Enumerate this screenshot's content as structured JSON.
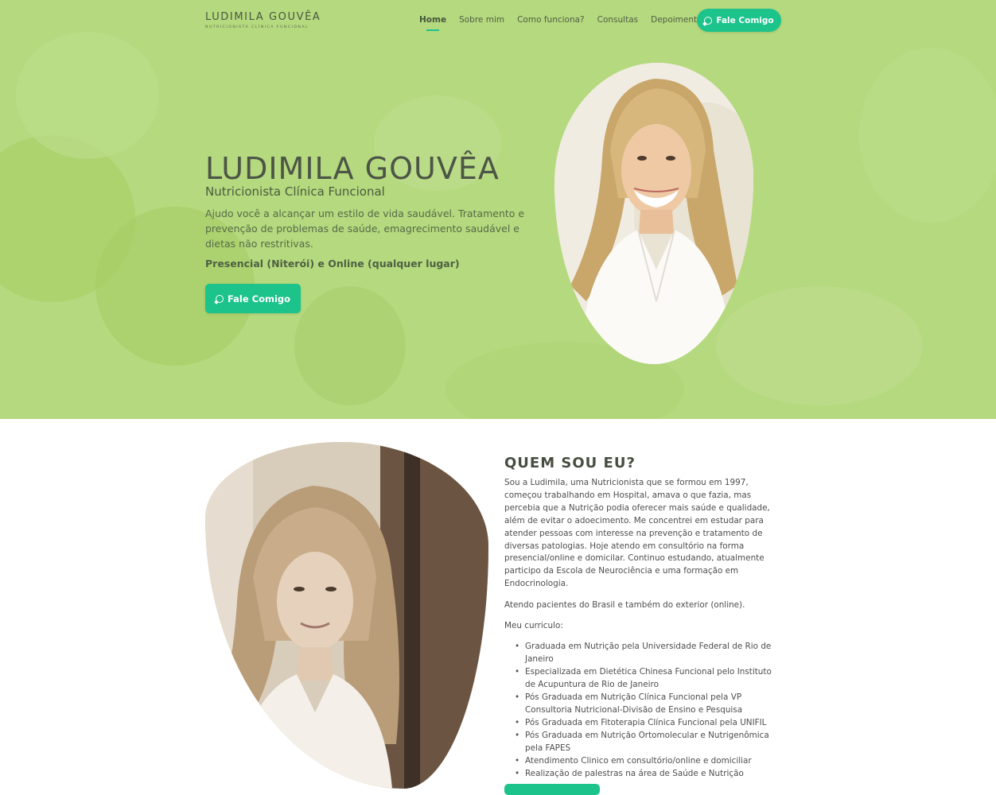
{
  "header": {
    "logo_main": "LUDIMILA GOUVÊA",
    "logo_sub": "NUTRICIONISTA CLÍNICA FUNCIONAL",
    "nav": [
      {
        "label": "Home",
        "active": true
      },
      {
        "label": "Sobre mim",
        "active": false
      },
      {
        "label": "Como funciona?",
        "active": false
      },
      {
        "label": "Consultas",
        "active": false
      },
      {
        "label": "Depoimentos",
        "active": false
      }
    ],
    "cta_label": "Fale Comigo",
    "cta_icon": "whatsapp-icon"
  },
  "hero": {
    "title": "LUDIMILA GOUVÊA",
    "subtitle": "Nutricionista Clínica Funcional",
    "description": "Ajudo você a alcançar um estilo de vida saudável. Tratamento e prevenção de problemas de saúde, emagrecimento saudável e dietas não restritivas.",
    "location": "Presencial (Niterói) e Online (qualquer lugar)",
    "cta_label": "Fale Comigo"
  },
  "about": {
    "title": "QUEM SOU EU?",
    "paragraphs": [
      "Sou a Ludimila, uma Nutricionista que se formou em 1997, começou trabalhando em Hospital, amava o que fazia, mas percebia que a Nutrição podia oferecer mais saúde e qualidade, além de evitar o adoecimento. Me concentrei em estudar para atender pessoas com interesse na prevenção e tratamento de diversas patologias. Hoje atendo em consultório na forma presencial/online e domicilar. Continuo estudando, atualmente participo da Escola de Neurociência e uma formação em Endocrinologia.",
      "Atendo pacientes do Brasil e também do exterior (online).",
      "Meu curriculo:"
    ],
    "curriculum": [
      "Graduada em Nutrição pela Universidade Federal de Rio de Janeiro",
      "Especializada em Dietética Chinesa Funcional pelo Instituto de Acupuntura de Rio de Janeiro",
      "Pós Graduada em Nutrição Clínica Funcional pela VP Consultoria Nutricional-Divisão de Ensino e Pesquisa",
      "Pós Graduada em Fitoterapia Clínica Funcional pela UNIFIL",
      "Pós Graduada em Nutrição Ortomolecular e Nutrigenômica pela FAPES",
      "Atendimento Clinico em consultório/online e domiciliar",
      "Realização de palestras na área de Saúde e Nutrição"
    ]
  },
  "colors": {
    "hero_bg": "#b5d97e",
    "accent": "#1cc38a"
  }
}
